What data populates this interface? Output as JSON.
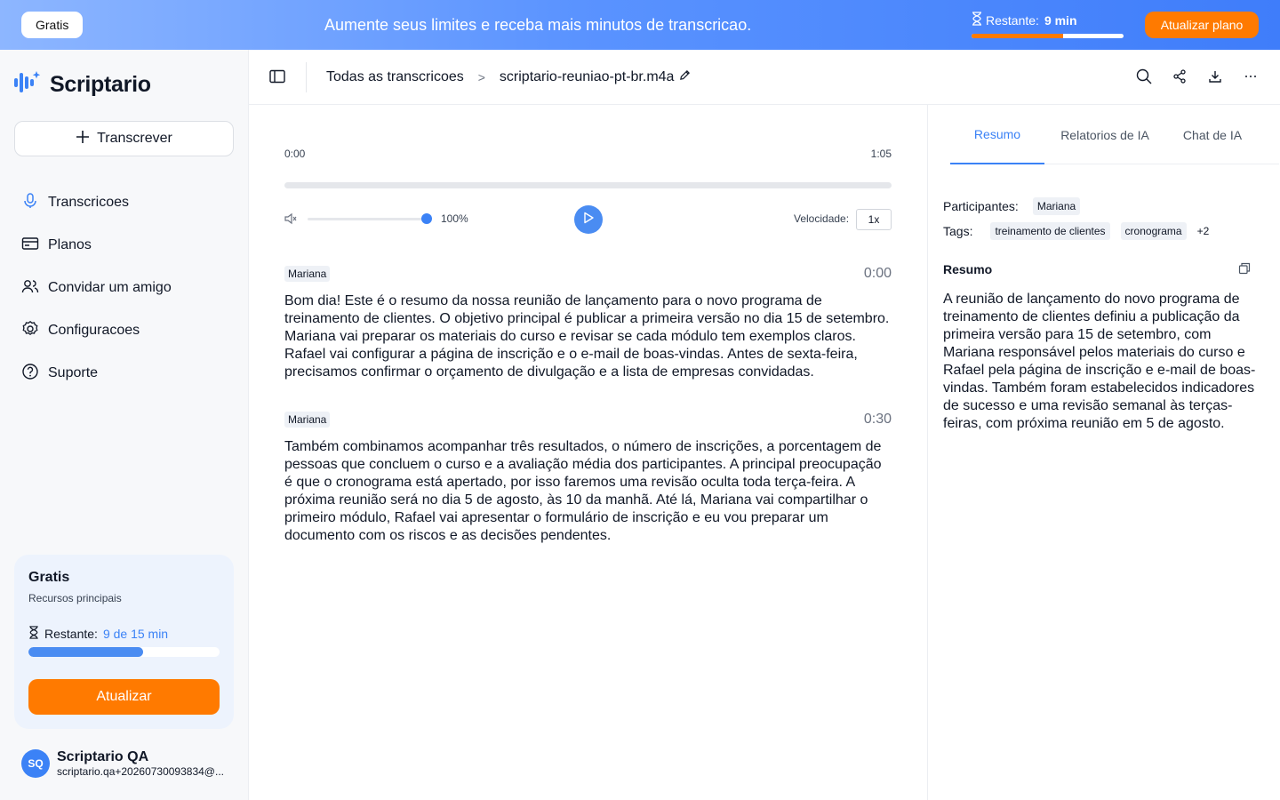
{
  "banner": {
    "plan_badge": "Gratis",
    "message": "Aumente seus limites e receba mais minutos de transcricao.",
    "remaining_label": "Restante:",
    "remaining_value": "9 min",
    "remaining_fraction": 0.6,
    "upgrade_button": "Atualizar plano",
    "colors": {
      "accent": "#ff7a00",
      "banner_start": "#8db6ff",
      "banner_end": "#3f7dfa"
    }
  },
  "sidebar": {
    "app_name": "Scriptario",
    "transcribe_button": "Transcrever",
    "items": [
      {
        "label": "Transcricoes",
        "icon": "microphone-icon"
      },
      {
        "label": "Planos",
        "icon": "card-icon"
      },
      {
        "label": "Convidar um amigo",
        "icon": "users-icon"
      },
      {
        "label": "Configuracoes",
        "icon": "gear-icon"
      },
      {
        "label": "Suporte",
        "icon": "help-icon"
      }
    ],
    "plan_card": {
      "title": "Gratis",
      "subtitle": "Recursos principais",
      "remaining_label": "Restante:",
      "remaining_value": "9 de 15 min",
      "remaining_fraction": 0.6,
      "button": "Atualizar"
    },
    "user": {
      "initials": "SQ",
      "name": "Scriptario QA",
      "email": "scriptario.qa+20260730093834@..."
    }
  },
  "header": {
    "breadcrumb_root": "Todas as transcricoes",
    "separator": ">",
    "file_name": "scriptario-reuniao-pt-br.m4a"
  },
  "player": {
    "current_time": "0:00",
    "duration": "1:05",
    "progress_fraction": 0.0,
    "volume_label": "100%",
    "volume_fraction": 1.0,
    "speed_label": "Velocidade:",
    "speed_value": "1x"
  },
  "transcript": [
    {
      "speaker": "Mariana",
      "timestamp": "0:00",
      "text": "Bom dia! Este é o resumo da nossa reunião de lançamento para o novo programa de treinamento de clientes. O objetivo principal é publicar a primeira versão no dia 15 de setembro. Mariana vai preparar os materiais do curso e revisar se cada módulo tem exemplos claros. Rafael vai configurar a página de inscrição e o e-mail de boas-vindas. Antes de sexta-feira, precisamos confirmar o orçamento de divulgação e a lista de empresas convidadas."
    },
    {
      "speaker": "Mariana",
      "timestamp": "0:30",
      "text": "Também combinamos acompanhar três resultados, o número de inscrições, a porcentagem de pessoas que concluem o curso e a avaliação média dos participantes. A principal preocupação é que o cronograma está apertado, por isso faremos uma revisão oculta toda terça-feira. A próxima reunião será no dia 5 de agosto, às 10 da manhã. Até lá, Mariana vai compartilhar o primeiro módulo, Rafael vai apresentar o formulário de inscrição e eu vou preparar um documento com os riscos e as decisões pendentes."
    }
  ],
  "right_panel": {
    "tabs": [
      "Resumo",
      "Relatorios de IA",
      "Chat de IA"
    ],
    "active_tab": "Resumo",
    "participants_label": "Participantes:",
    "participants": [
      "Mariana"
    ],
    "tags_label": "Tags:",
    "tags": [
      "treinamento de clientes",
      "cronograma"
    ],
    "tags_more": "+2",
    "summary_title": "Resumo",
    "summary_text": "A reunião de lançamento do novo programa de treinamento de clientes definiu a publicação da primeira versão para 15 de setembro, com Mariana responsável pelos materiais do curso e Rafael pela página de inscrição e e-mail de boas-vindas. Também foram estabelecidos indicadores de sucesso e uma revisão semanal às terças-feiras, com próxima reunião em 5 de agosto."
  }
}
